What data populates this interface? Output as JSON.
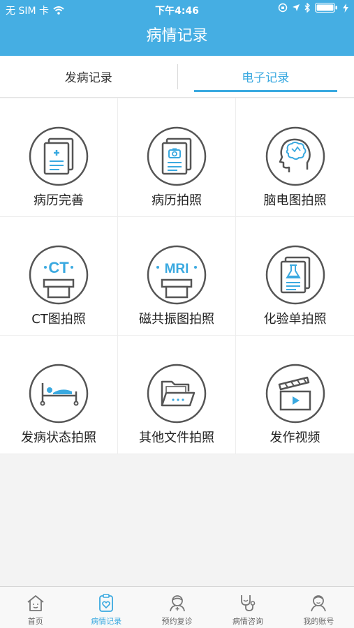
{
  "status_bar": {
    "carrier": "无 SIM 卡",
    "time": "下午4:46"
  },
  "header": {
    "title": "病情记录"
  },
  "tabs": [
    {
      "label": "发病记录",
      "active": false
    },
    {
      "label": "电子记录",
      "active": true
    }
  ],
  "grid_items": [
    {
      "label": "病历完善",
      "icon": "record-edit-icon"
    },
    {
      "label": "病历拍照",
      "icon": "record-camera-icon"
    },
    {
      "label": "脑电图拍照",
      "icon": "brain-eeg-icon"
    },
    {
      "label": "CT图拍照",
      "icon": "ct-scan-icon",
      "icon_text": "CT"
    },
    {
      "label": "磁共振图拍照",
      "icon": "mri-scan-icon",
      "icon_text": "MRI"
    },
    {
      "label": "化验单拍照",
      "icon": "lab-report-icon"
    },
    {
      "label": "发病状态拍照",
      "icon": "patient-bed-icon"
    },
    {
      "label": "其他文件拍照",
      "icon": "folder-icon"
    },
    {
      "label": "发作视频",
      "icon": "video-clapper-icon"
    }
  ],
  "bottom_nav": [
    {
      "label": "首页",
      "icon": "home-icon",
      "active": false
    },
    {
      "label": "病情记录",
      "icon": "clipboard-heart-icon",
      "active": true
    },
    {
      "label": "预约复诊",
      "icon": "doctor-icon",
      "active": false
    },
    {
      "label": "病情咨询",
      "icon": "stethoscope-icon",
      "active": false
    },
    {
      "label": "我的账号",
      "icon": "account-icon",
      "active": false
    }
  ],
  "colors": {
    "brand": "#45aee3",
    "accent": "#3aa9e0",
    "icon_stroke": "#555555"
  }
}
